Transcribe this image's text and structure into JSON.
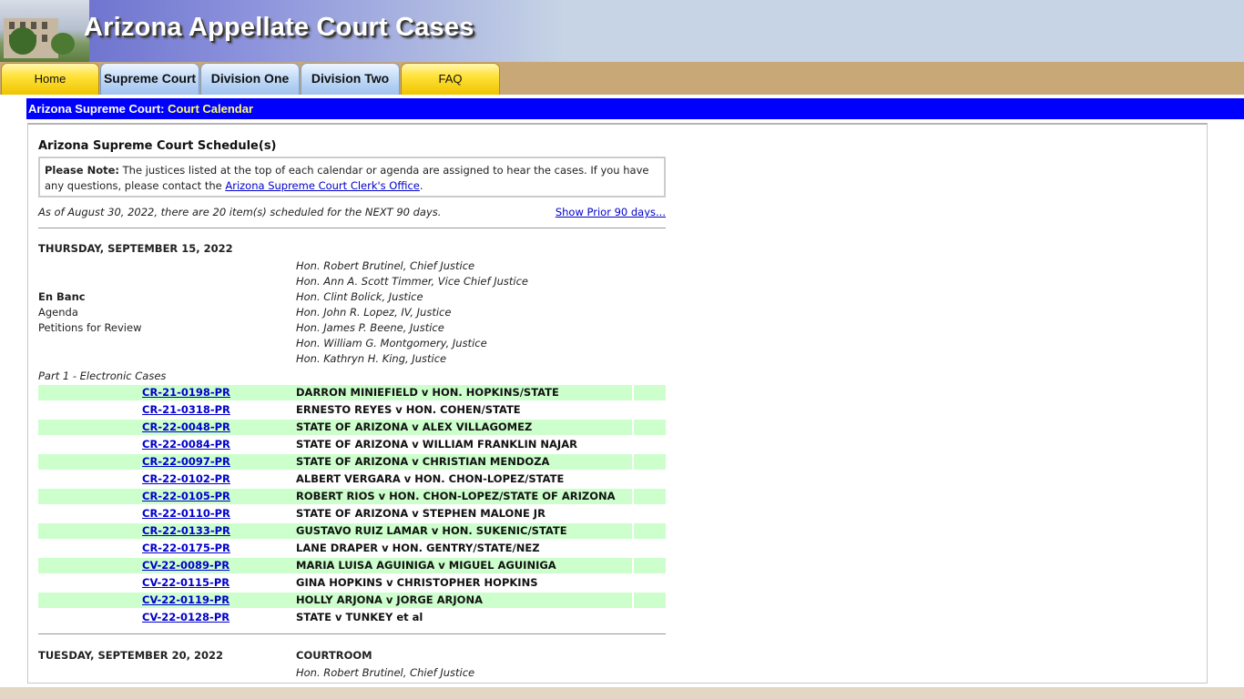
{
  "site": {
    "title": "Arizona Appellate Court Cases"
  },
  "nav": {
    "tabs": [
      {
        "label": "Home"
      },
      {
        "label": "Supreme Court"
      },
      {
        "label": "Division One"
      },
      {
        "label": "Division Two"
      },
      {
        "label": "FAQ"
      }
    ]
  },
  "breadcrumb": {
    "section": "Arizona Supreme Court:",
    "page": "Court Calendar"
  },
  "schedule": {
    "heading": "Arizona Supreme Court Schedule(s)",
    "note_label": "Please Note:",
    "note_text": "The justices listed at the top of each calendar or agenda are assigned to hear the cases. If you have any questions, please contact the",
    "note_link": "Arizona Supreme Court Clerk's Office",
    "note_end": ".",
    "as_of": "As of August 30, 2022, there are 20 item(s) scheduled for the NEXT 90 days.",
    "prior_link": "Show Prior 90 days..."
  },
  "calendars": [
    {
      "date": "THURSDAY, SEPTEMBER 15, 2022",
      "justices": [
        "Hon. Robert Brutinel, Chief Justice",
        "Hon. Ann A. Scott Timmer, Vice Chief Justice",
        "Hon. Clint Bolick, Justice",
        "Hon. John R. Lopez, IV, Justice",
        "Hon. James P. Beene, Justice",
        "Hon. William G. Montgomery, Justice",
        "Hon. Kathryn H. King, Justice"
      ],
      "type": "En Banc",
      "kind": "Agenda",
      "category": "Petitions for Review",
      "part": "Part 1 - Electronic Cases",
      "cases": [
        {
          "number": "CR-21-0198-PR",
          "title": "DARRON MINIEFIELD v HON. HOPKINS/STATE"
        },
        {
          "number": "CR-21-0318-PR",
          "title": "ERNESTO REYES v HON. COHEN/STATE"
        },
        {
          "number": "CR-22-0048-PR",
          "title": "STATE OF ARIZONA v ALEX VILLAGOMEZ"
        },
        {
          "number": "CR-22-0084-PR",
          "title": "STATE OF ARIZONA v WILLIAM FRANKLIN NAJAR"
        },
        {
          "number": "CR-22-0097-PR",
          "title": "STATE OF ARIZONA v CHRISTIAN MENDOZA"
        },
        {
          "number": "CR-22-0102-PR",
          "title": "ALBERT VERGARA v HON. CHON-LOPEZ/STATE"
        },
        {
          "number": "CR-22-0105-PR",
          "title": "ROBERT RIOS v HON. CHON-LOPEZ/STATE OF ARIZONA"
        },
        {
          "number": "CR-22-0110-PR",
          "title": "STATE OF ARIZONA v STEPHEN MALONE JR"
        },
        {
          "number": "CR-22-0133-PR",
          "title": "GUSTAVO RUIZ LAMAR v HON. SUKENIC/STATE"
        },
        {
          "number": "CR-22-0175-PR",
          "title": "LANE DRAPER v HON. GENTRY/STATE/NEZ"
        },
        {
          "number": "CV-22-0089-PR",
          "title": "MARIA LUISA AGUINIGA v MIGUEL AGUINIGA"
        },
        {
          "number": "CV-22-0115-PR",
          "title": "GINA HOPKINS v CHRISTOPHER HOPKINS"
        },
        {
          "number": "CV-22-0119-PR",
          "title": "HOLLY ARJONA v JORGE ARJONA"
        },
        {
          "number": "CV-22-0128-PR",
          "title": "STATE v TUNKEY et al"
        }
      ]
    },
    {
      "date": "TUESDAY, SEPTEMBER 20, 2022",
      "location": "COURTROOM",
      "justices": [
        "Hon. Robert Brutinel, Chief Justice"
      ]
    }
  ],
  "colors": {
    "breadcrumb_bg": "#0000ff",
    "breadcrumb_accent": "#ffff66",
    "nav_bg": "#c9a878",
    "row_alt": "#ccffcc",
    "link": "#0000cc"
  }
}
